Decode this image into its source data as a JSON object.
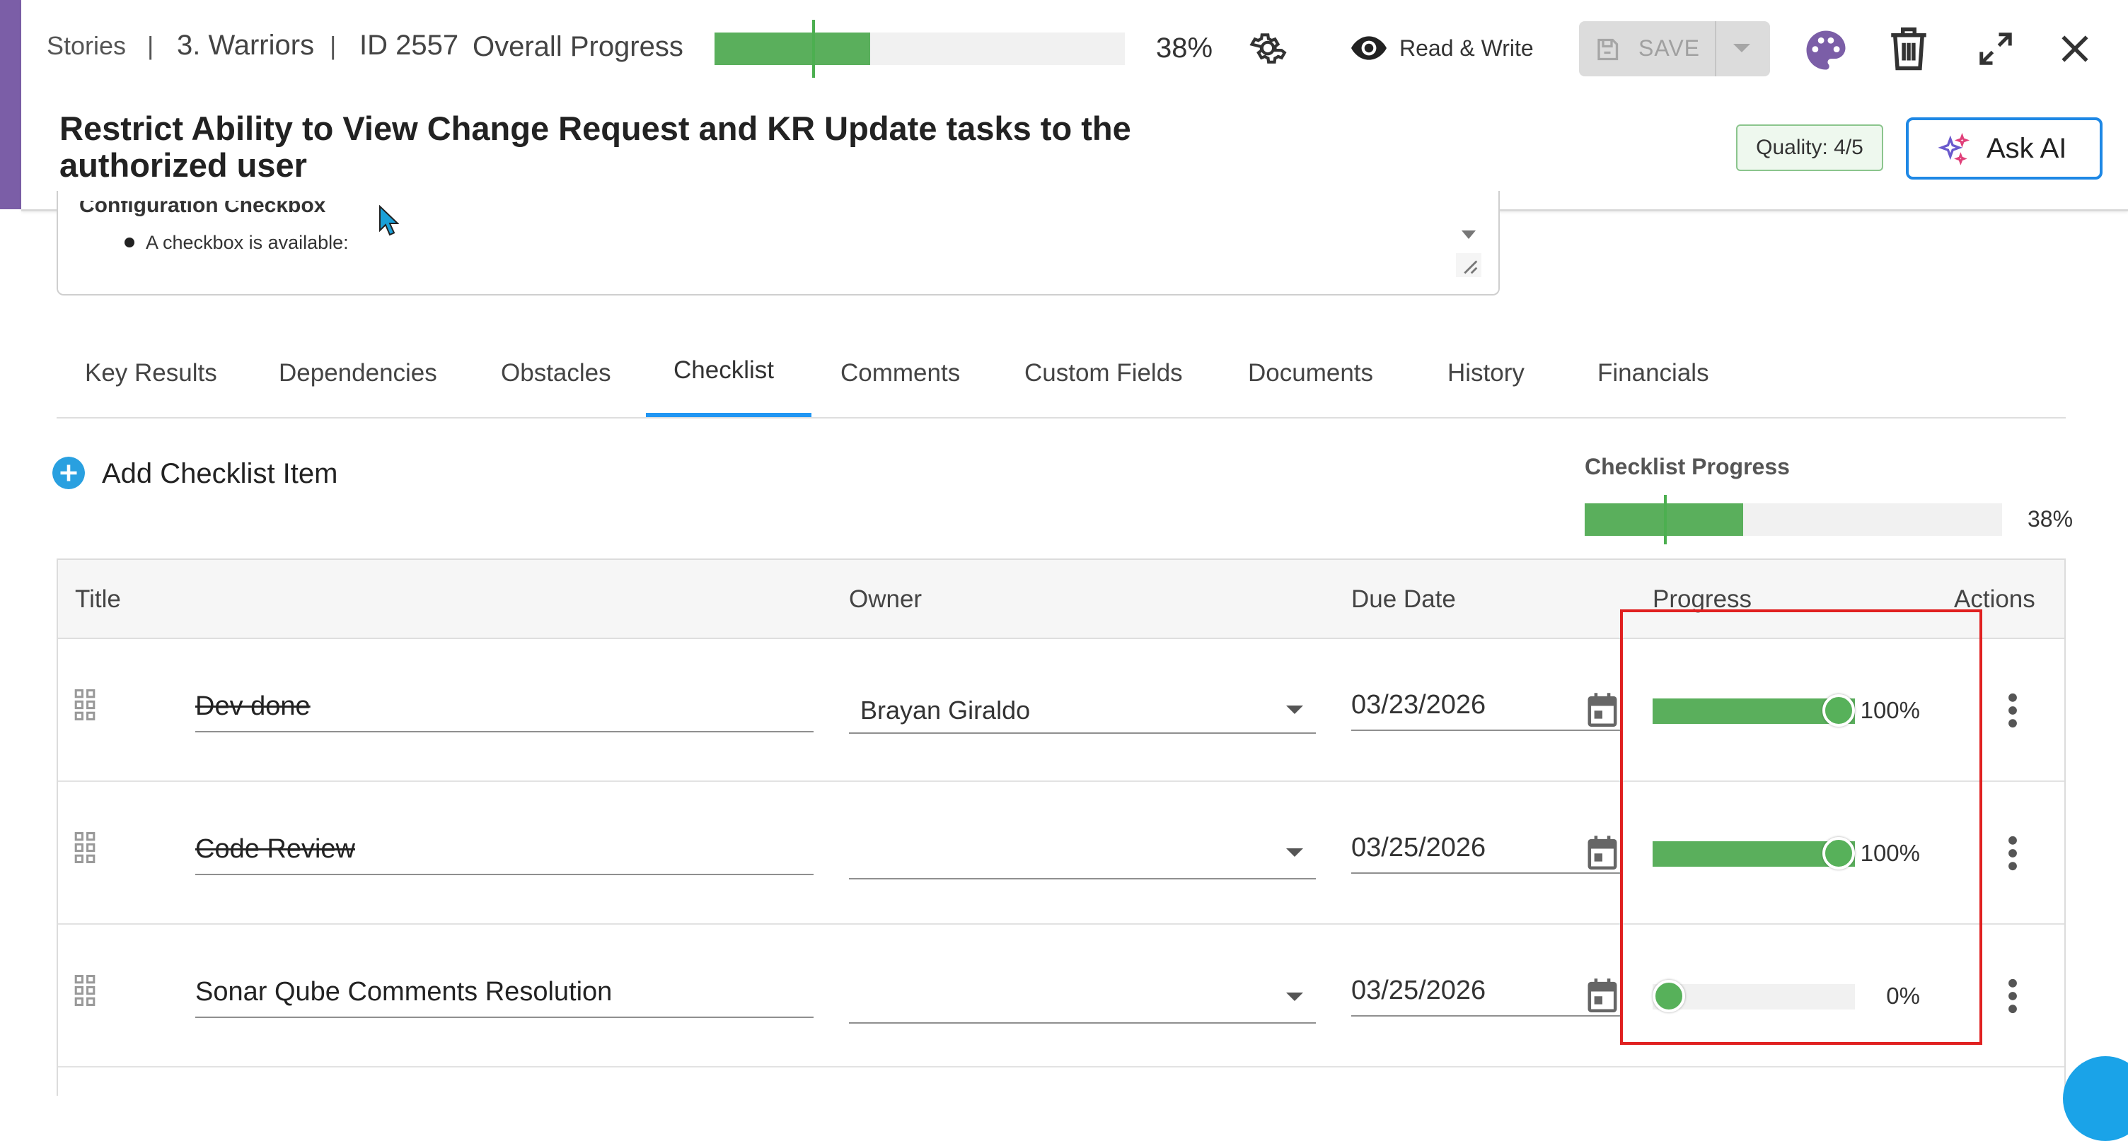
{
  "header": {
    "breadcrumb_section": "Stories",
    "separator": "|",
    "breadcrumb_team": "3. Warriors",
    "breadcrumb_id": "ID 2557",
    "overall_progress_label": "Overall Progress",
    "overall_progress_value": 0.38,
    "overall_progress_text": "38%",
    "mode_label": "Read & Write",
    "save_label": "SAVE",
    "story_title": "Restrict Ability to View Change Request and KR Update tasks to the authorized user",
    "quality_badge": "Quality: 4/5",
    "ask_ai_label": "Ask AI"
  },
  "description": {
    "heading": "Configuration Checkbox",
    "bullet": "A checkbox is available:"
  },
  "tabs": [
    {
      "label": "Key Results",
      "active": false
    },
    {
      "label": "Dependencies",
      "active": false
    },
    {
      "label": "Obstacles",
      "active": false
    },
    {
      "label": "Checklist",
      "active": true
    },
    {
      "label": "Comments",
      "active": false
    },
    {
      "label": "Custom Fields",
      "active": false
    },
    {
      "label": "Documents",
      "active": false
    },
    {
      "label": "History",
      "active": false
    },
    {
      "label": "Financials",
      "active": false
    }
  ],
  "checklist": {
    "add_label": "Add Checklist Item",
    "progress_label": "Checklist Progress",
    "progress_value": 0.38,
    "progress_text": "38%",
    "columns": [
      "Title",
      "Owner",
      "Due Date",
      "Progress",
      "Actions"
    ],
    "rows": [
      {
        "title": "Dev done",
        "owner": "Brayan Giraldo",
        "due": "03/23/2026",
        "progress": 1.0,
        "progress_text": "100%",
        "completed": true
      },
      {
        "title": "Code Review",
        "owner": "",
        "due": "03/25/2026",
        "progress": 1.0,
        "progress_text": "100%",
        "completed": true
      },
      {
        "title": "Sonar Qube Comments Resolution",
        "owner": "",
        "due": "03/25/2026",
        "progress": 0.0,
        "progress_text": "0%",
        "completed": false
      }
    ]
  },
  "colors": {
    "accent_purple": "#7b5ea7",
    "progress_green": "#5aaf5c",
    "tab_active_blue": "#2196f3",
    "highlight_red": "#e02020",
    "add_blue": "#29a0e0"
  },
  "icons": [
    "gear-icon",
    "eye-icon",
    "save-disk-icon",
    "palette-icon",
    "trash-icon",
    "expand-icon",
    "close-icon",
    "sparkle-icon",
    "plus-icon",
    "drag-handle-icon",
    "calendar-icon",
    "kebab-menu-icon",
    "cursor-icon"
  ]
}
